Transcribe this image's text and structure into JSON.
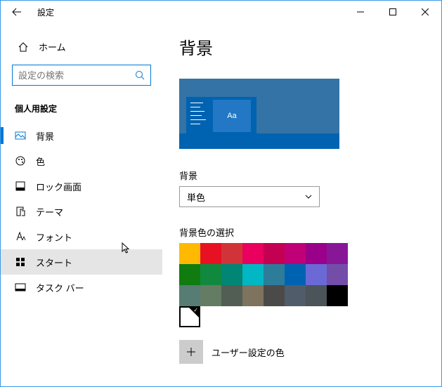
{
  "titlebar": {
    "title": "設定"
  },
  "sidebar": {
    "home_label": "ホーム",
    "search_placeholder": "設定の検索",
    "section_header": "個人用設定",
    "items": [
      {
        "label": "背景"
      },
      {
        "label": "色"
      },
      {
        "label": "ロック画面"
      },
      {
        "label": "テーマ"
      },
      {
        "label": "フォント"
      },
      {
        "label": "スタート"
      },
      {
        "label": "タスク バー"
      }
    ]
  },
  "main": {
    "heading": "背景",
    "preview_tile_text": "Aa",
    "bg_label": "背景",
    "bg_dropdown_value": "単色",
    "color_label": "背景色の選択",
    "colors": [
      "#ffb900",
      "#e81123",
      "#d13438",
      "#ea005e",
      "#c30052",
      "#bf0077",
      "#9a0089",
      "#881798",
      "#107c10",
      "#10893e",
      "#018574",
      "#00b7c3",
      "#2d7d9a",
      "#0063b1",
      "#6b69d6",
      "#744da9",
      "#567c73",
      "#647c64",
      "#525e54",
      "#7e735f",
      "#4c4a48",
      "#515c6b",
      "#4a5459",
      "#000000",
      "#ffffff"
    ],
    "selected_color_index": 24,
    "custom_color_label": "ユーザー設定の色"
  }
}
